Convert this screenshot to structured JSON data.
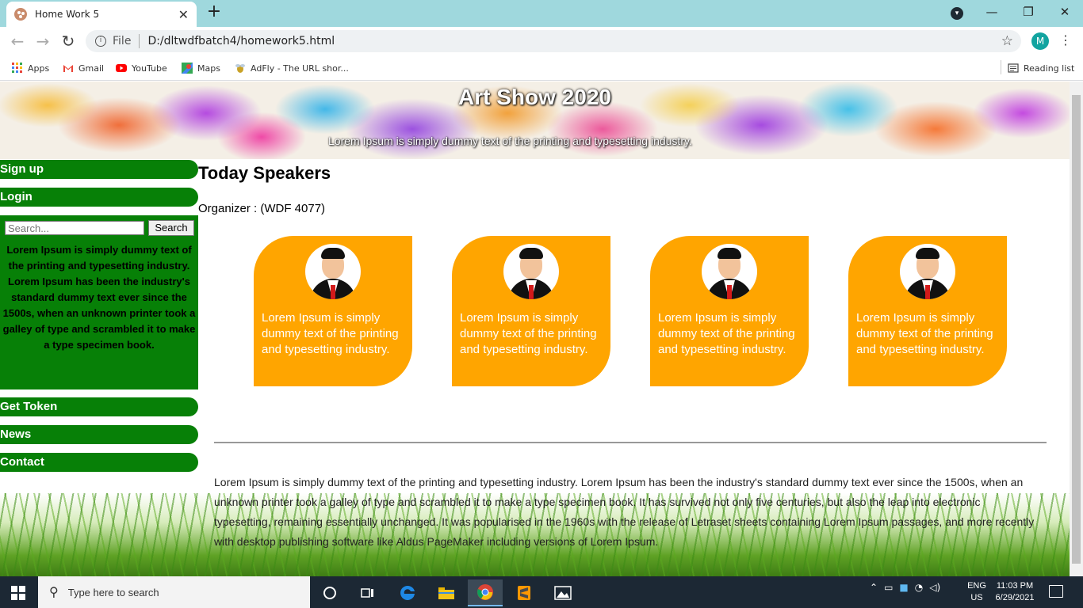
{
  "browser": {
    "tab_title": "Home Work 5",
    "tab_close": "✕",
    "new_tab": "+",
    "url_scheme_label": "File",
    "url": "D:/dltwdfbatch4/homework5.html",
    "profile_initial": "M",
    "window_min": "—",
    "window_restore": "❐",
    "window_close": "✕",
    "bookmarks": [
      {
        "label": "Apps",
        "icon": "apps-grid-icon"
      },
      {
        "label": "Gmail",
        "icon": "gmail-icon"
      },
      {
        "label": "YouTube",
        "icon": "youtube-icon"
      },
      {
        "label": "Maps",
        "icon": "maps-icon"
      },
      {
        "label": "AdFly - The URL shor...",
        "icon": "adfly-icon"
      }
    ],
    "reading_list": "Reading list"
  },
  "page": {
    "banner_title": "Art Show 2020",
    "banner_subtitle": "Lorem Ipsum is simply dummy text of the printing and typesetting industry.",
    "sidebar": {
      "signup": "Sign up",
      "login": "Login",
      "search_placeholder": "Search...",
      "search_button": "Search",
      "text": "Lorem Ipsum is simply dummy text of the printing and typesetting industry. Lorem Ipsum has been the industry's standard dummy text ever since the 1500s, when an unknown printer took a galley of type and scrambled it to make a type specimen book.",
      "get_token": "Get Token",
      "news": "News",
      "contact": "Contact"
    },
    "speakers_heading": "Today Speakers",
    "organizer": "Organizer : (WDF 4077)",
    "cards": [
      {
        "text": "Lorem Ipsum is simply dummy text of the printing and typesetting industry."
      },
      {
        "text": "Lorem Ipsum is simply dummy text of the printing and typesetting industry."
      },
      {
        "text": "Lorem Ipsum is simply dummy text of the printing and typesetting industry."
      },
      {
        "text": "Lorem Ipsum is simply dummy text of the printing and typesetting industry."
      }
    ],
    "paragraph": "Lorem Ipsum is simply dummy text of the printing and typesetting industry. Lorem Ipsum has been the industry's standard dummy text ever since the 1500s, when an unknown printer took a galley of type and scrambled it to make a type specimen book. It has survived not only five centuries, but also the leap into electronic typesetting, remaining essentially unchanged. It was popularised in the 1960s with the release of Letraset sheets containing Lorem Ipsum passages, and more recently with desktop publishing software like Aldus PageMaker including versions of Lorem Ipsum."
  },
  "taskbar": {
    "search_placeholder": "Type here to search",
    "lang_line1": "ENG",
    "lang_line2": "US",
    "time": "11:03 PM",
    "date": "6/29/2021"
  },
  "colors": {
    "sidebar_green": "#078007",
    "card_orange": "#ffa500",
    "tabstrip": "#9fd8dd"
  }
}
